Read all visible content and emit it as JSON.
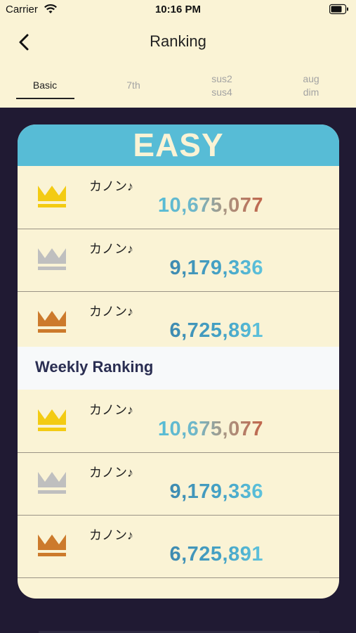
{
  "status_bar": {
    "carrier": "Carrier",
    "time": "10:16 PM"
  },
  "nav": {
    "title": "Ranking",
    "back_icon": "chevron-left-icon"
  },
  "tabs": [
    {
      "label": "Basic",
      "active": true
    },
    {
      "label": "7th",
      "active": false
    },
    {
      "label": "sus2\nsus4",
      "active": false
    },
    {
      "label": "aug\ndim",
      "active": false
    }
  ],
  "card": {
    "title": "EASY",
    "overall": [
      {
        "name": "カノン♪",
        "score": "10,675,077",
        "crown": "gold-crown-icon"
      },
      {
        "name": "カノン♪",
        "score": "9,179,336",
        "crown": "silver-crown-icon"
      },
      {
        "name": "カノン♪",
        "score": "6,725,891",
        "crown": "bronze-crown-icon"
      }
    ],
    "weekly_label": "Weekly Ranking",
    "weekly": [
      {
        "name": "カノン♪",
        "score": "10,675,077",
        "crown": "gold-crown-icon"
      },
      {
        "name": "カノン♪",
        "score": "9,179,336",
        "crown": "silver-crown-icon"
      },
      {
        "name": "カノン♪",
        "score": "6,725,891",
        "crown": "bronze-crown-icon"
      }
    ]
  },
  "colors": {
    "header_bg": "#57bcd6",
    "card_bg": "#faf3d5",
    "page_bg": "#201a33",
    "gold": "#f3cb13",
    "silver": "#bfbfbf",
    "bronze": "#cc7a2c"
  }
}
